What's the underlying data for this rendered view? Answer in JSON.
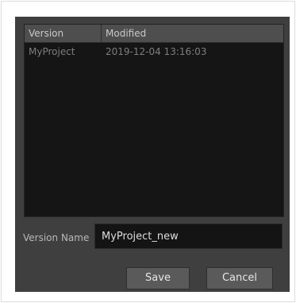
{
  "table": {
    "headers": {
      "version": "Version",
      "modified": "Modified"
    },
    "rows": [
      {
        "version": "MyProject",
        "modified": "2019-12-04 13:16:03"
      }
    ]
  },
  "version_name": {
    "label": "Version Name",
    "value": "MyProject_new"
  },
  "buttons": {
    "save": "Save",
    "cancel": "Cancel"
  },
  "colors": {
    "dialog_bg": "#3f3f3f",
    "table_bg": "#151515",
    "header_bg": "#4e4e4e",
    "button_bg": "#5a5a5a"
  }
}
